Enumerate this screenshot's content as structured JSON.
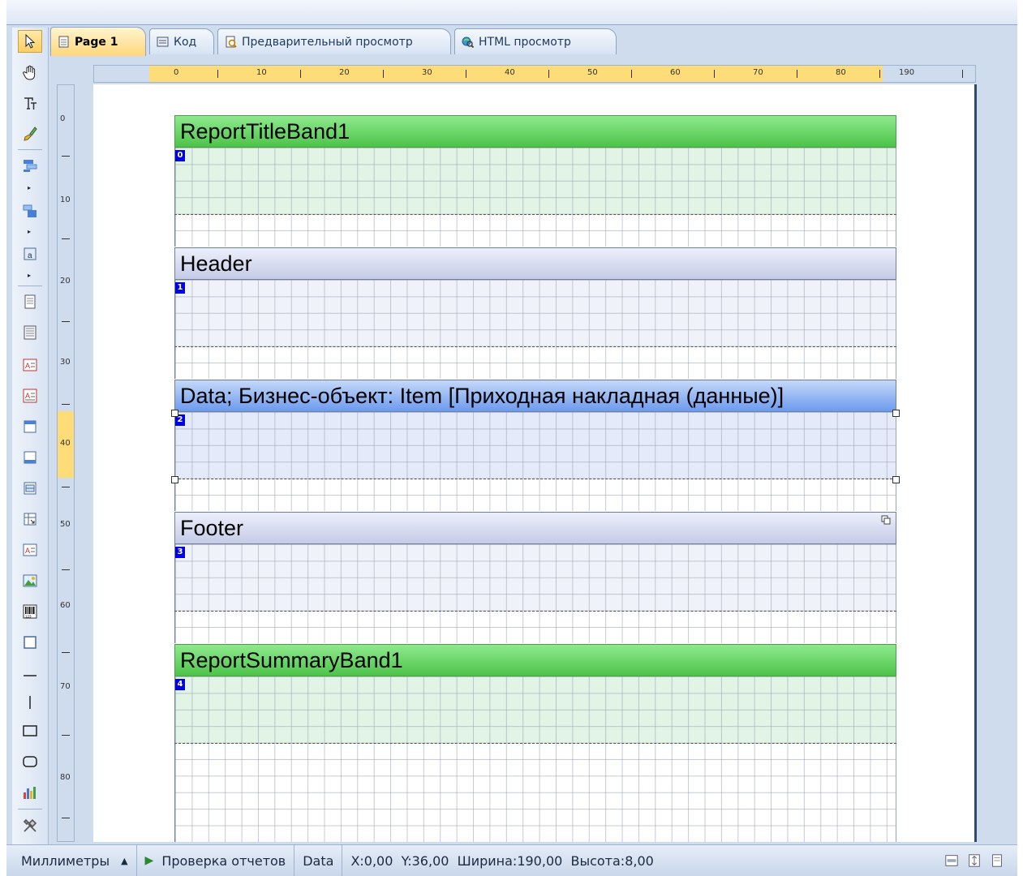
{
  "tabs": [
    {
      "label": "Page 1",
      "icon": "page-icon",
      "active": true
    },
    {
      "label": "Код",
      "icon": "code-icon"
    },
    {
      "label": "Предварительный просмотр",
      "icon": "preview-icon"
    },
    {
      "label": "HTML просмотр",
      "icon": "html-preview-icon"
    }
  ],
  "hruler_labels": [
    "0",
    "10",
    "20",
    "30",
    "40",
    "50",
    "60",
    "70",
    "80",
    "190"
  ],
  "vruler_labels": [
    "0",
    "10",
    "20",
    "30",
    "40",
    "50",
    "60",
    "70",
    "80"
  ],
  "bands": [
    {
      "title": "ReportTitleBand1",
      "index": "0",
      "style": "green"
    },
    {
      "title": "Header",
      "index": "1",
      "style": "lav"
    },
    {
      "title": "Data; Бизнес-объект: Item [Приходная накладная (данные)]",
      "index": "2",
      "style": "blue"
    },
    {
      "title": "Footer",
      "index": "3",
      "style": "lav"
    },
    {
      "title": "ReportSummaryBand1",
      "index": "4",
      "style": "green"
    }
  ],
  "status": {
    "units": "Миллиметры",
    "check": "Проверка отчетов",
    "component": "Data",
    "coords": "X:0,00  Y:36,00  Ширина:190,00  Высота:8,00"
  },
  "colors": {
    "accent": "#ffd67a",
    "band_green": "#4dc449",
    "band_blue": "#6c9bee",
    "band_lavender": "#c5cbe7"
  }
}
